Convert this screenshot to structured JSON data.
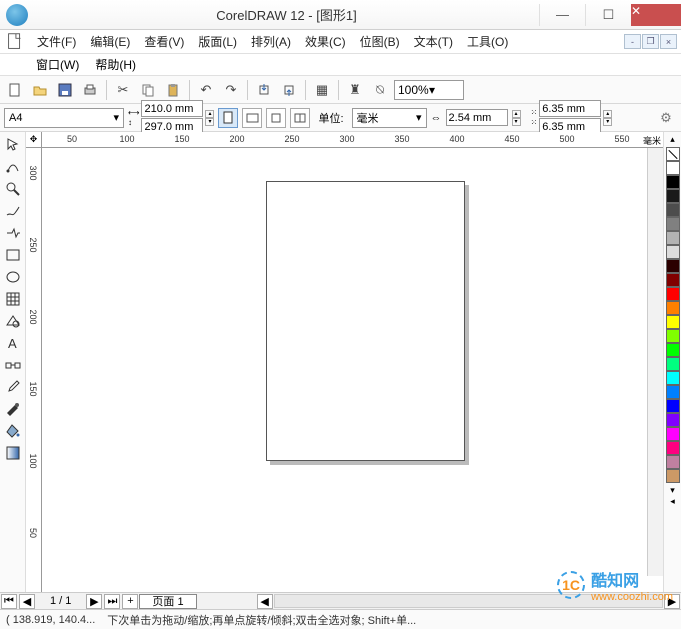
{
  "title": "CorelDRAW 12 - [图形1]",
  "menu": {
    "file": "文件(F)",
    "edit": "编辑(E)",
    "view": "查看(V)",
    "layout": "版面(L)",
    "arrange": "排列(A)",
    "effects": "效果(C)",
    "bitmaps": "位图(B)",
    "text": "文本(T)",
    "tools": "工具(O)",
    "window": "窗口(W)",
    "help": "帮助(H)"
  },
  "toolbar": {
    "zoom": "100%"
  },
  "propbar": {
    "paper": "A4",
    "width": "210.0 mm",
    "height": "297.0 mm",
    "unit_label": "单位:",
    "unit": "毫米",
    "nudge": "2.54 mm",
    "dup_x": "6.35 mm",
    "dup_y": "6.35 mm"
  },
  "ruler": {
    "h": [
      "50",
      "100",
      "150",
      "200",
      "250",
      "300",
      "350",
      "400",
      "450",
      "500",
      "550"
    ],
    "v": [
      "300",
      "250",
      "200",
      "150",
      "100",
      "50"
    ],
    "unit": "毫米"
  },
  "palette": [
    "#ffffff",
    "#000000",
    "#1a1a1a",
    "#4d4d4d",
    "#808080",
    "#b3b3b3",
    "#dcdcdc",
    "#2b0000",
    "#800000",
    "#ff0000",
    "#ff8000",
    "#ffff00",
    "#80ff00",
    "#00ff00",
    "#00ff80",
    "#00ffff",
    "#0080ff",
    "#0000ff",
    "#8000ff",
    "#ff00ff",
    "#ff0080",
    "#c080a0",
    "#cc9966"
  ],
  "pagenav": {
    "pages": "1 / 1",
    "tab": "页面 1"
  },
  "status": {
    "coords": "( 138.919, 140.4...",
    "hint": "下次单击为拖动/缩放;再单点旋转/倾斜;双击全选对象; Shift+单..."
  },
  "watermark": {
    "name": "酷知网",
    "url": "www.coozhi.com",
    "logo": "1C"
  }
}
